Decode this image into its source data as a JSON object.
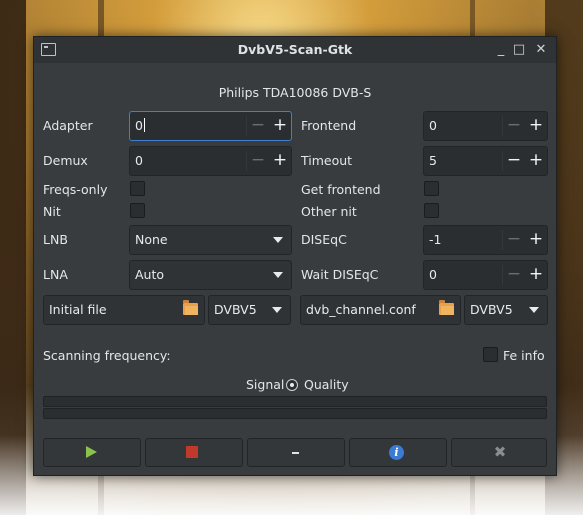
{
  "window": {
    "title": "DvbV5-Scan-Gtk",
    "minimize": "_",
    "maximize": "□",
    "close": "✕"
  },
  "device": "Philips TDA10086 DVB-S",
  "fields": {
    "adapter": {
      "label": "Adapter",
      "value": "0"
    },
    "frontend": {
      "label": "Frontend",
      "value": "0"
    },
    "demux": {
      "label": "Demux",
      "value": "0"
    },
    "timeout": {
      "label": "Timeout",
      "value": "5"
    },
    "freqs_only": {
      "label": "Freqs-only"
    },
    "get_frontend": {
      "label": "Get frontend"
    },
    "nit": {
      "label": "Nit"
    },
    "other_nit": {
      "label": "Other nit"
    },
    "lnb": {
      "label": "LNB",
      "value": "None"
    },
    "diseqc": {
      "label": "DISEqC",
      "value": "-1"
    },
    "lna": {
      "label": "LNA",
      "value": "Auto"
    },
    "wait_diseqc": {
      "label": "Wait DISEqC",
      "value": "0"
    }
  },
  "files": {
    "initial": {
      "label": "Initial file",
      "format": "DVBV5"
    },
    "output": {
      "label": "dvb_channel.conf",
      "format": "DVBV5"
    }
  },
  "scanning": {
    "label": "Scanning frequency:",
    "fe_info": "Fe info"
  },
  "signal": {
    "signal_label": "Signal",
    "quality_label": "Quality"
  },
  "spin_symbols": {
    "minus": "−",
    "plus": "+"
  },
  "actions": {
    "minimize_symbol": "_",
    "info_symbol": "i",
    "close_symbol": "✖"
  }
}
